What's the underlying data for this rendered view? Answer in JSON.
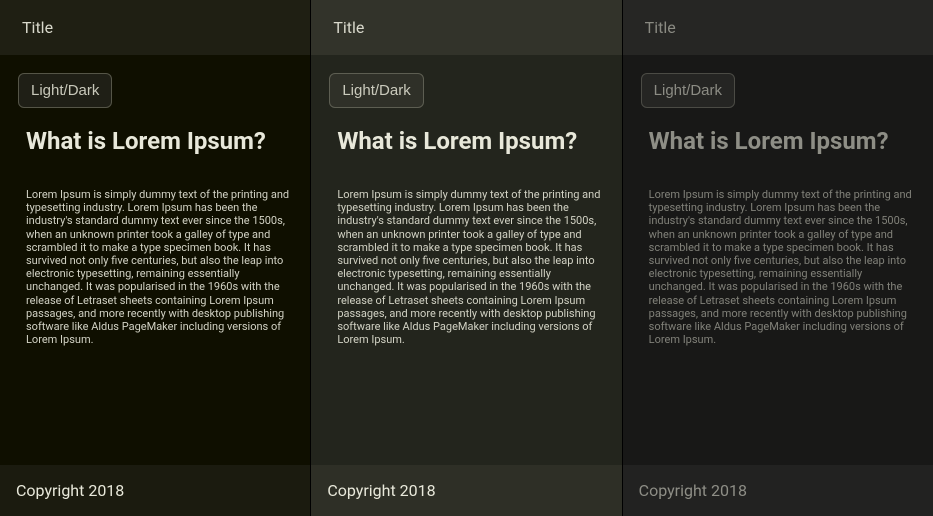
{
  "columns": [
    {
      "title": "Title",
      "toggle_label": "Light/Dark",
      "heading": "What is Lorem Ipsum?",
      "body": "Lorem Ipsum is simply dummy text of the printing and typesetting industry. Lorem Ipsum has been the industry's standard dummy text ever since the 1500s, when an unknown printer took a galley of type and scrambled it to make a type specimen book. It has survived not only five centuries, but also the leap into electronic typesetting, remaining essentially unchanged. It was popularised in the 1960s with the release of Letraset sheets containing Lorem Ipsum passages, and more recently with desktop publishing software like Aldus PageMaker including versions of Lorem Ipsum.",
      "copyright": "Copyright 2018"
    },
    {
      "title": "Title",
      "toggle_label": "Light/Dark",
      "heading": "What is Lorem Ipsum?",
      "body": "Lorem Ipsum is simply dummy text of the printing and typesetting industry. Lorem Ipsum has been the industry's standard dummy text ever since the 1500s, when an unknown printer took a galley of type and scrambled it to make a type specimen book. It has survived not only five centuries, but also the leap into electronic typesetting, remaining essentially unchanged. It was popularised in the 1960s with the release of Letraset sheets containing Lorem Ipsum passages, and more recently with desktop publishing software like Aldus PageMaker including versions of Lorem Ipsum.",
      "copyright": "Copyright 2018"
    },
    {
      "title": "Title",
      "toggle_label": "Light/Dark",
      "heading": "What is Lorem Ipsum?",
      "body": "Lorem Ipsum is simply dummy text of the printing and typesetting industry. Lorem Ipsum has been the industry's standard dummy text ever since the 1500s, when an unknown printer took a galley of type and scrambled it to make a type specimen book. It has survived not only five centuries, but also the leap into electronic typesetting, remaining essentially unchanged. It was popularised in the 1960s with the release of Letraset sheets containing Lorem Ipsum passages, and more recently with desktop publishing software like Aldus PageMaker including versions of Lorem Ipsum.",
      "copyright": "Copyright 2018"
    }
  ]
}
